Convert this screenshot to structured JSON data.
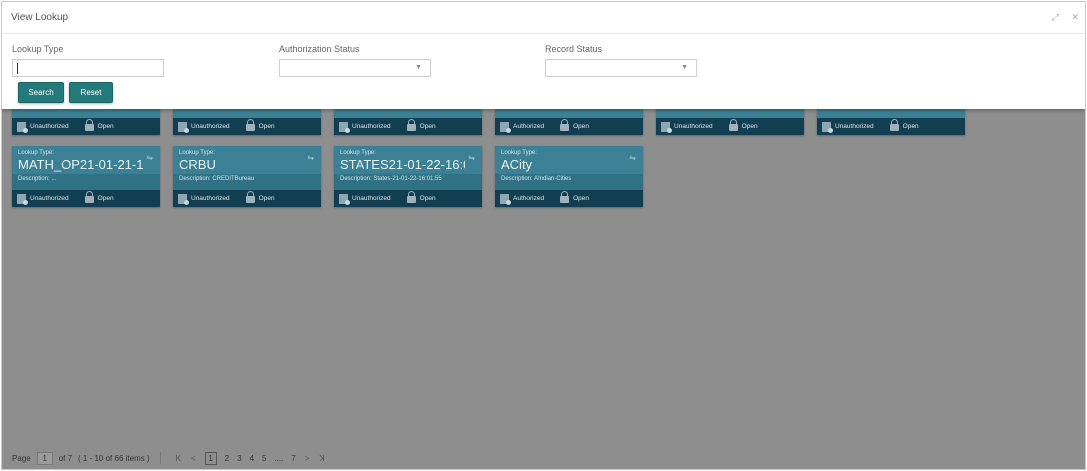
{
  "window": {
    "title": "View Lookup",
    "controls": [
      "expand-icon",
      "close-icon"
    ]
  },
  "search": {
    "lookup_type_label": "Lookup Type",
    "auth_status_label": "Authorization Status",
    "record_status_label": "Record Status",
    "search_label": "Search",
    "reset_label": "Reset"
  },
  "cards_row1": [
    {
      "auth": "Unauthorized",
      "status": "Open"
    },
    {
      "auth": "Unauthorized",
      "status": "Open"
    },
    {
      "auth": "Unauthorized",
      "status": "Open"
    },
    {
      "auth": "Authorized",
      "status": "Open"
    },
    {
      "auth": "Unauthorized",
      "status": "Open"
    },
    {
      "auth": "Unauthorized",
      "status": "Open"
    }
  ],
  "cards_row2": [
    {
      "type_label": "Lookup Type:",
      "type": "MATH_OP21-01-21-1...",
      "desc": "Description: ...",
      "auth": "Unauthorized",
      "status": "Open"
    },
    {
      "type_label": "Lookup Type:",
      "type": "CRBU",
      "desc": "Description: CREDITBureau",
      "auth": "Unauthorized",
      "status": "Open"
    },
    {
      "type_label": "Lookup Type:",
      "type": "STATES21-01-22-16:0...",
      "desc": "Description: States-21-01-22-16:01:55",
      "auth": "Unauthorized",
      "status": "Open"
    },
    {
      "type_label": "Lookup Type:",
      "type": "ACity",
      "desc": "Description: AIndian-Cities",
      "auth": "Authorized",
      "status": "Open"
    }
  ],
  "pagination": {
    "page_label": "Page",
    "current": "1",
    "of_total": "of 7",
    "items_info": "( 1 - 10 of 66 items )",
    "first": "K",
    "prev": "<",
    "pages": [
      "1",
      "2",
      "3",
      "4",
      "5",
      "....",
      "7"
    ],
    "next": ">",
    "last": "ꓘ"
  }
}
